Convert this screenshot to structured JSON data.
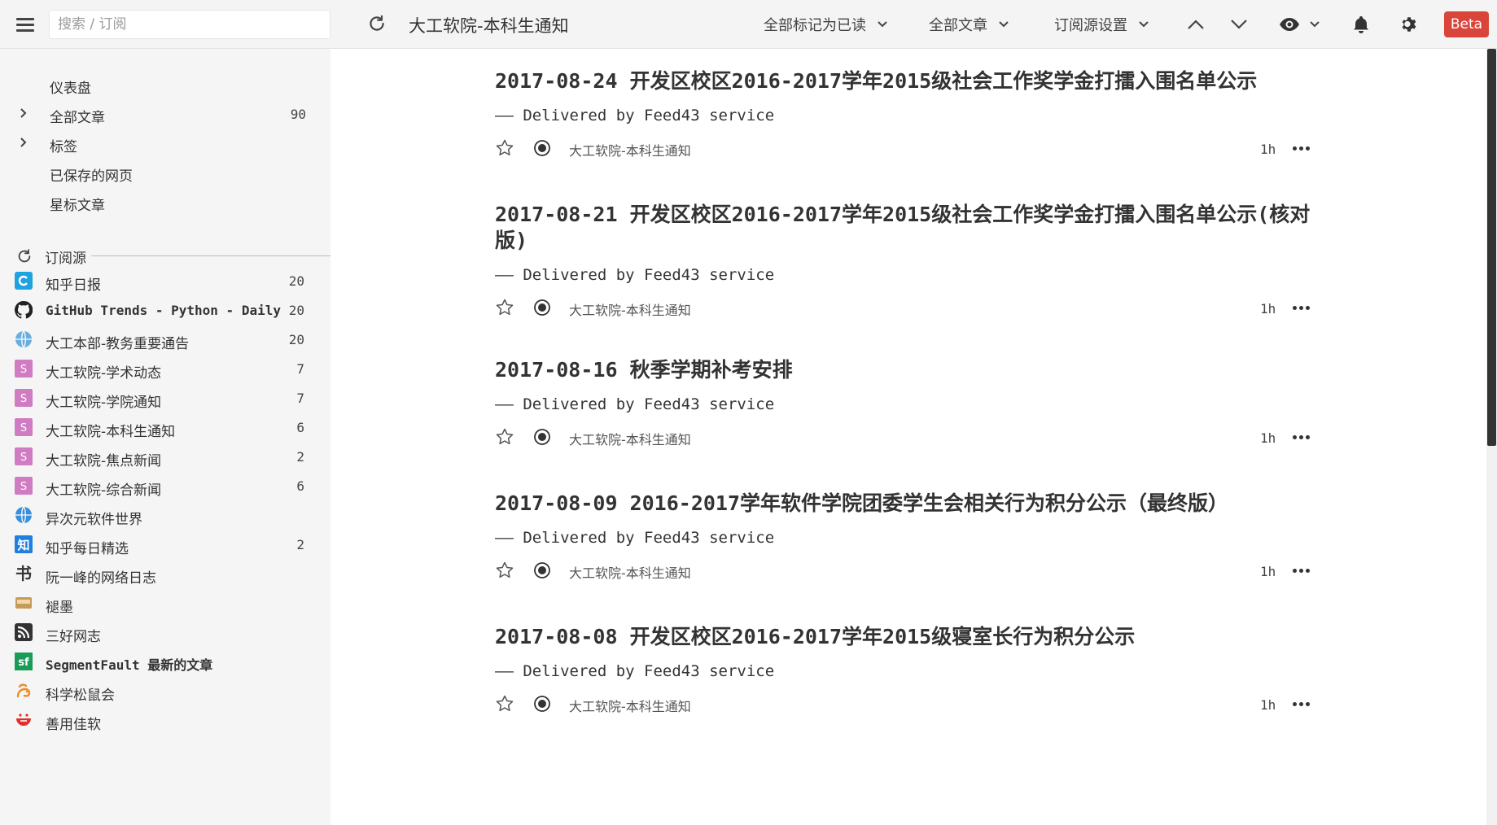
{
  "topbar": {
    "search_placeholder": "搜索 / 订阅",
    "feed_title": "大工软院-本科生通知",
    "mark_all_read": "全部标记为已读",
    "all_articles": "全部文章",
    "feed_settings": "订阅源设置",
    "beta": "Beta"
  },
  "sidebar": {
    "nav": [
      {
        "label": "仪表盘",
        "count": ""
      },
      {
        "label": "全部文章",
        "count": "90"
      },
      {
        "label": "标签",
        "count": ""
      },
      {
        "label": "已保存的网页",
        "count": ""
      },
      {
        "label": "星标文章",
        "count": ""
      }
    ],
    "section_title": "订阅源",
    "feeds": [
      {
        "name": "知乎日报",
        "count": "20",
        "icon": "zhihu-daily-icon",
        "icon_color": "#1fa3e0"
      },
      {
        "name": "GitHub Trends - Python - Daily",
        "count": "20",
        "icon": "github-icon",
        "icon_color": "#222222"
      },
      {
        "name": "大工本部-教务重要通告",
        "count": "20",
        "icon": "globe-icon",
        "icon_color": "#6aaee0"
      },
      {
        "name": "大工软院-学术动态",
        "count": "7",
        "icon": "s-icon",
        "icon_color": "#d07cc2",
        "glyph": "S"
      },
      {
        "name": "大工软院-学院通知",
        "count": "7",
        "icon": "s-icon",
        "icon_color": "#d07cc2",
        "glyph": "S"
      },
      {
        "name": "大工软院-本科生通知",
        "count": "6",
        "icon": "s-icon",
        "icon_color": "#d07cc2",
        "glyph": "S"
      },
      {
        "name": "大工软院-焦点新闻",
        "count": "2",
        "icon": "s-icon",
        "icon_color": "#d07cc2",
        "glyph": "S"
      },
      {
        "name": "大工软院-综合新闻",
        "count": "6",
        "icon": "s-icon",
        "icon_color": "#d07cc2",
        "glyph": "S"
      },
      {
        "name": "异次元软件世界",
        "count": "",
        "icon": "globe-icon",
        "icon_color": "#3b8fd8"
      },
      {
        "name": "知乎每日精选",
        "count": "2",
        "icon": "zhihu-icon",
        "icon_color": "#1e7fe0",
        "glyph": "知"
      },
      {
        "name": "阮一峰的网络日志",
        "count": "",
        "icon": "calligraphy-icon",
        "icon_color": "#333333",
        "glyph": "书"
      },
      {
        "name": "褪墨",
        "count": "",
        "icon": "inbox-icon",
        "icon_color": "#c89a5a"
      },
      {
        "name": "三好网志",
        "count": "",
        "icon": "rss-icon",
        "icon_color": "#333333"
      },
      {
        "name": "SegmentFault 最新的文章",
        "count": "",
        "icon": "segmentfault-icon",
        "icon_color": "#1a9b58",
        "glyph": "sf"
      },
      {
        "name": "科学松鼠会",
        "count": "",
        "icon": "squirrel-icon",
        "icon_color": "#f08a24"
      },
      {
        "name": "善用佳软",
        "count": "",
        "icon": "smile-icon",
        "icon_color": "#e0302a"
      }
    ]
  },
  "articles": [
    {
      "title": "2017-08-24 开发区校区2016-2017学年2015级社会工作奖学金打擂入围名单公示",
      "summary": "—— Delivered by Feed43 service",
      "source": "大工软院-本科生通知",
      "time": "1h"
    },
    {
      "title": "2017-08-21 开发区校区2016-2017学年2015级社会工作奖学金打擂入围名单公示(核对版)",
      "summary": "—— Delivered by Feed43 service",
      "source": "大工软院-本科生通知",
      "time": "1h"
    },
    {
      "title": "2017-08-16 秋季学期补考安排",
      "summary": "—— Delivered by Feed43 service",
      "source": "大工软院-本科生通知",
      "time": "1h"
    },
    {
      "title": "2017-08-09 2016-2017学年软件学院团委学生会相关行为积分公示（最终版）",
      "summary": "—— Delivered by Feed43 service",
      "source": "大工软院-本科生通知",
      "time": "1h"
    },
    {
      "title": "2017-08-08 开发区校区2016-2017学年2015级寝室长行为积分公示",
      "summary": "—— Delivered by Feed43 service",
      "source": "大工软院-本科生通知",
      "time": "1h"
    }
  ]
}
